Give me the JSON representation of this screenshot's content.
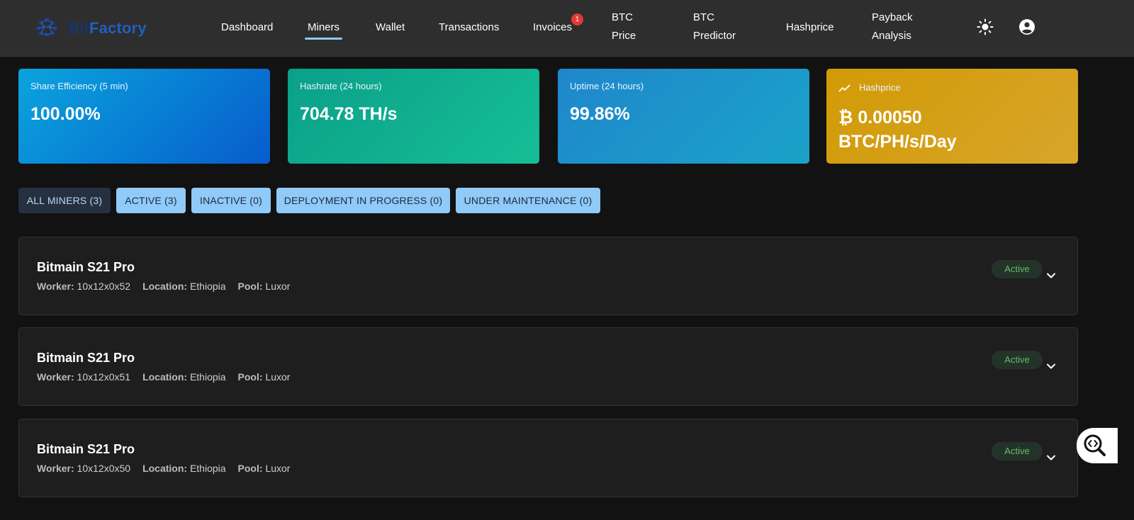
{
  "brand": {
    "name_prefix": "Bit",
    "name_suffix": "Factory",
    "logo_color": "#1f5fbf"
  },
  "nav": {
    "dashboard": "Dashboard",
    "miners": "Miners",
    "wallet": "Wallet",
    "transactions": "Transactions",
    "invoices": "Invoices",
    "invoices_badge": "1",
    "btc_price_1": "BTC",
    "btc_price_2": "Price",
    "btc_predictor_1": "BTC",
    "btc_predictor_2": "Predictor",
    "hashprice": "Hashprice",
    "payback_1": "Payback",
    "payback_2": "Analysis",
    "active_item": "Miners"
  },
  "icons": {
    "theme_toggle": "sun-icon",
    "account": "account-circle-icon",
    "card4": "trending-up-icon",
    "row_toggle": "chevron-down-icon",
    "floating": "code-search-icon"
  },
  "stats": {
    "share_efficiency": {
      "label": "Share Efficiency (5 min)",
      "value": "100.00%"
    },
    "hashrate": {
      "label": "Hashrate (24 hours)",
      "value": "704.78 TH/s"
    },
    "uptime": {
      "label": "Uptime (24 hours)",
      "value": "99.86%"
    },
    "hashprice": {
      "label": "Hashprice",
      "value_line1": "₿ 0.00050",
      "value_line2": "BTC/PH/s/Day"
    }
  },
  "filters": {
    "all": "ALL MINERS (3)",
    "active": "ACTIVE (3)",
    "inactive": "INACTIVE (0)",
    "deployment": "DEPLOYMENT IN PROGRESS (0)",
    "maintenance": "UNDER MAINTENANCE (0)"
  },
  "labels": {
    "worker": "Worker:",
    "location": "Location:",
    "pool": "Pool:"
  },
  "miners": [
    {
      "name": "Bitmain S21 Pro",
      "worker": "10x12x0x52",
      "location": "Ethiopia",
      "pool": "Luxor",
      "status": "Active"
    },
    {
      "name": "Bitmain S21 Pro",
      "worker": "10x12x0x51",
      "location": "Ethiopia",
      "pool": "Luxor",
      "status": "Active"
    },
    {
      "name": "Bitmain S21 Pro",
      "worker": "10x12x0x50",
      "location": "Ethiopia",
      "pool": "Luxor",
      "status": "Active"
    }
  ],
  "colors": {
    "active_status": "#66bb6a",
    "accent": "#90caf9",
    "badge": "#e53935"
  }
}
